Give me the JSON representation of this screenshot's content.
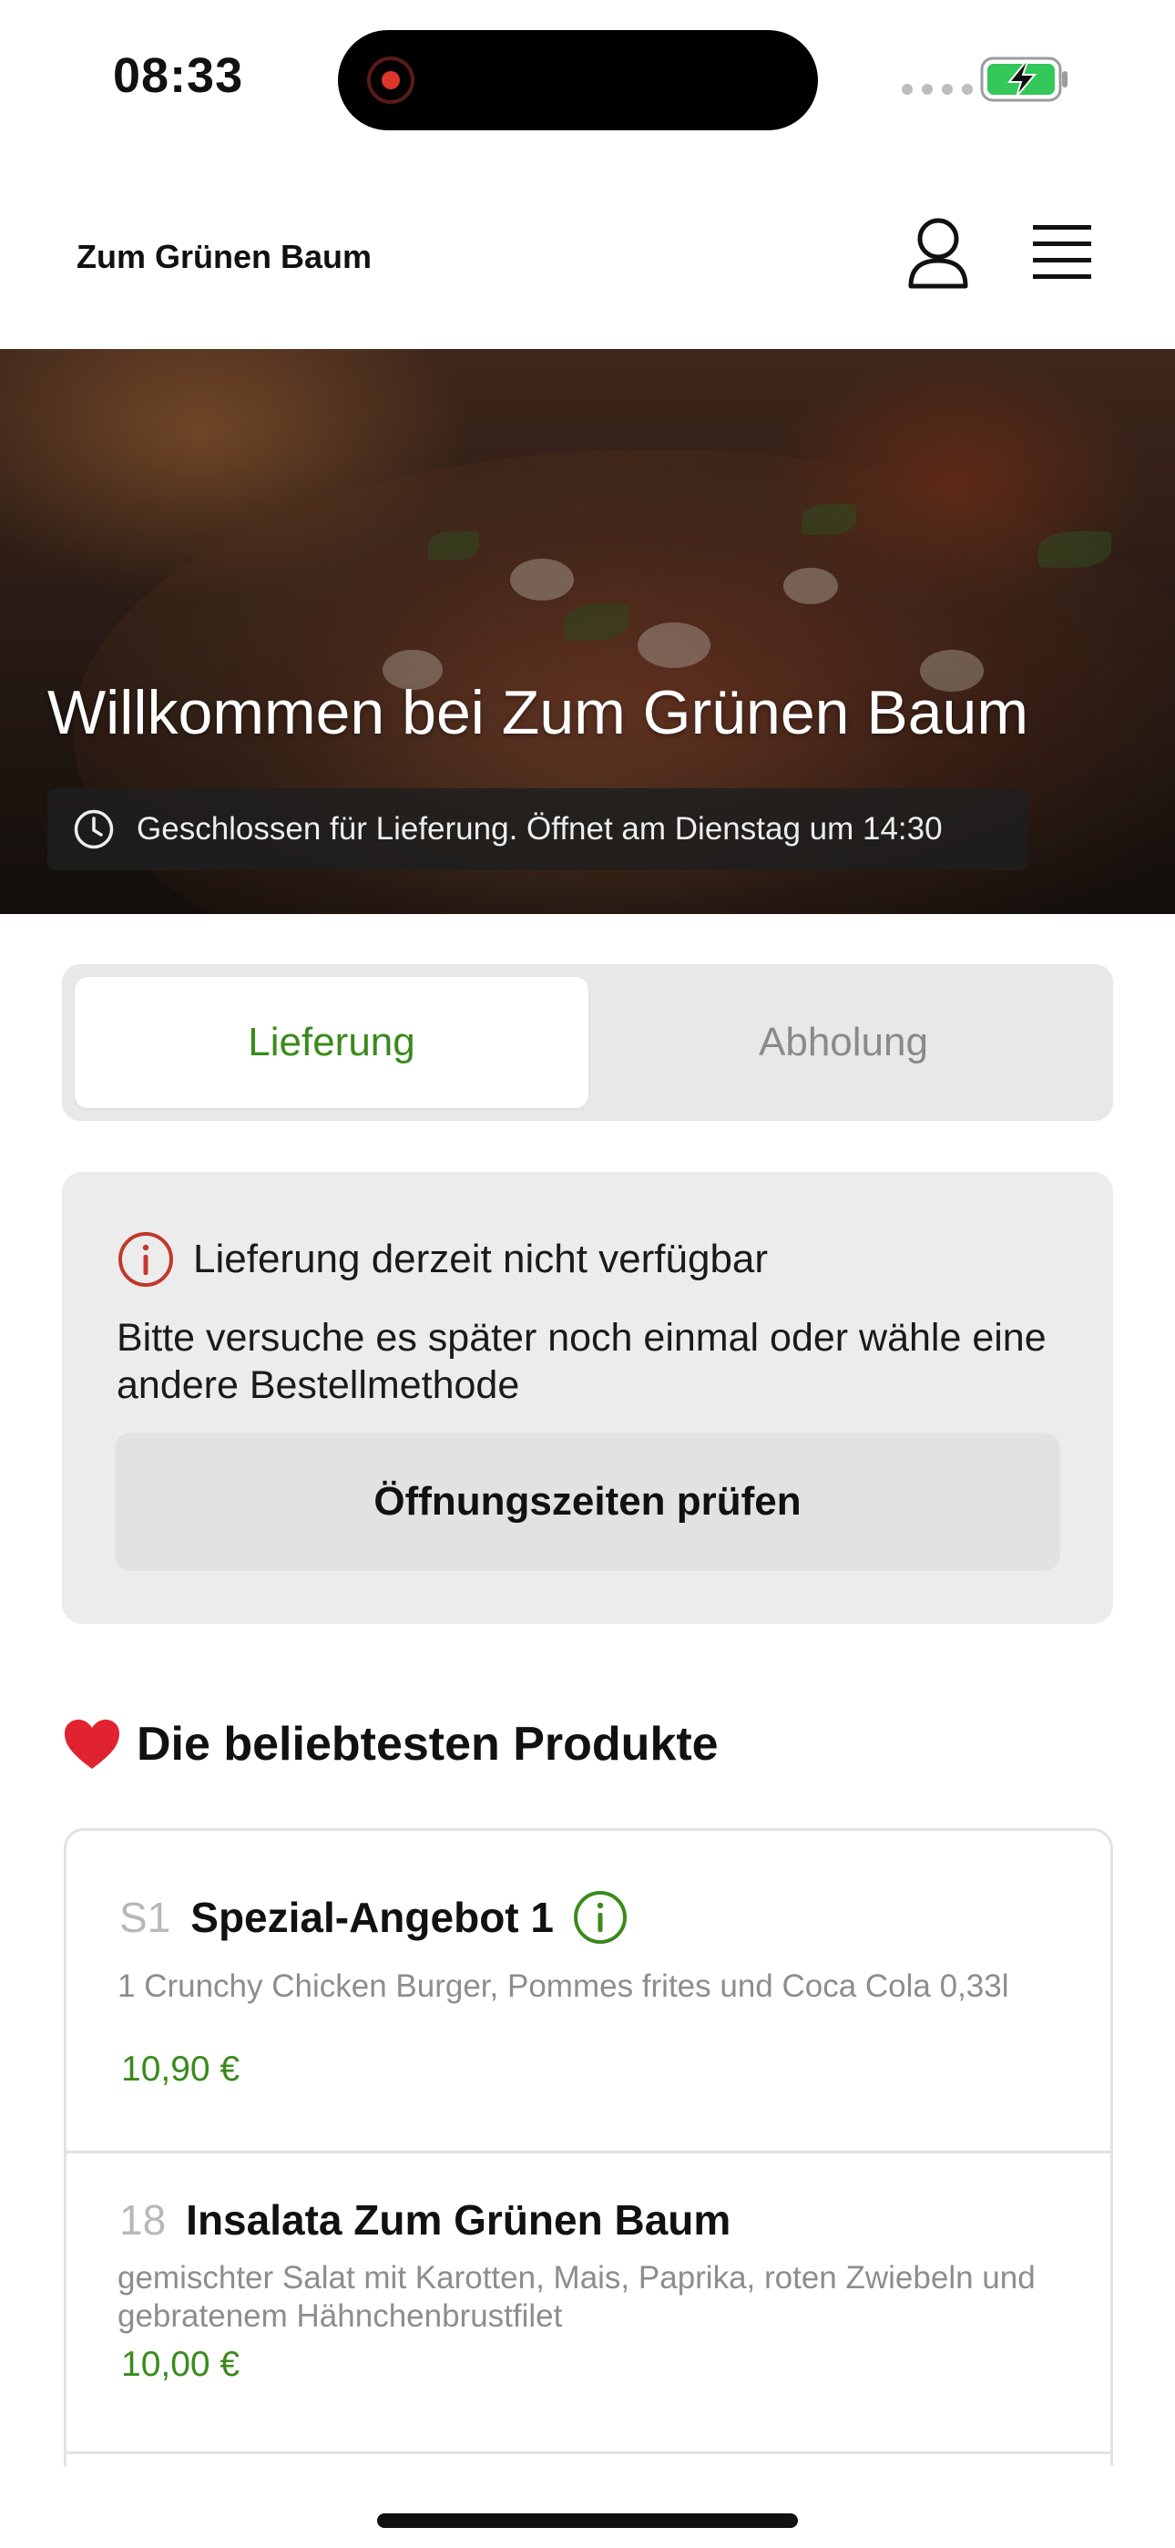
{
  "status_bar": {
    "time": "08:33"
  },
  "header": {
    "brand": "Zum Grünen Baum"
  },
  "hero": {
    "title": "Willkommen bei Zum Grünen Baum",
    "status": "Geschlossen für Lieferung. Öffnet am Dienstag um 14:30"
  },
  "order_mode": {
    "tabs": [
      {
        "label": "Lieferung",
        "active": true
      },
      {
        "label": "Abholung",
        "active": false
      }
    ]
  },
  "notice": {
    "title": "Lieferung derzeit nicht verfügbar",
    "message": "Bitte versuche es später noch einmal oder wähle eine andere Bestellmethode",
    "button": "Öffnungszeiten prüfen"
  },
  "popular": {
    "title": "Die beliebtesten Produkte",
    "products": [
      {
        "code": "S1",
        "name": "Spezial-Angebot 1",
        "description": "1 Crunchy Chicken Burger, Pommes frites und Coca Cola 0,33l",
        "price": "10,90 €"
      },
      {
        "code": "18",
        "name": "Insalata Zum Grünen Baum",
        "description": "gemischter Salat mit Karotten, Mais, Paprika, roten Zwiebeln und gebratenem Hähnchenbrustfilet",
        "price": "10,00 €"
      }
    ]
  },
  "colors": {
    "accent_green": "#3a8a1c",
    "alert_red": "#c0392b",
    "battery_green": "#34c759"
  }
}
